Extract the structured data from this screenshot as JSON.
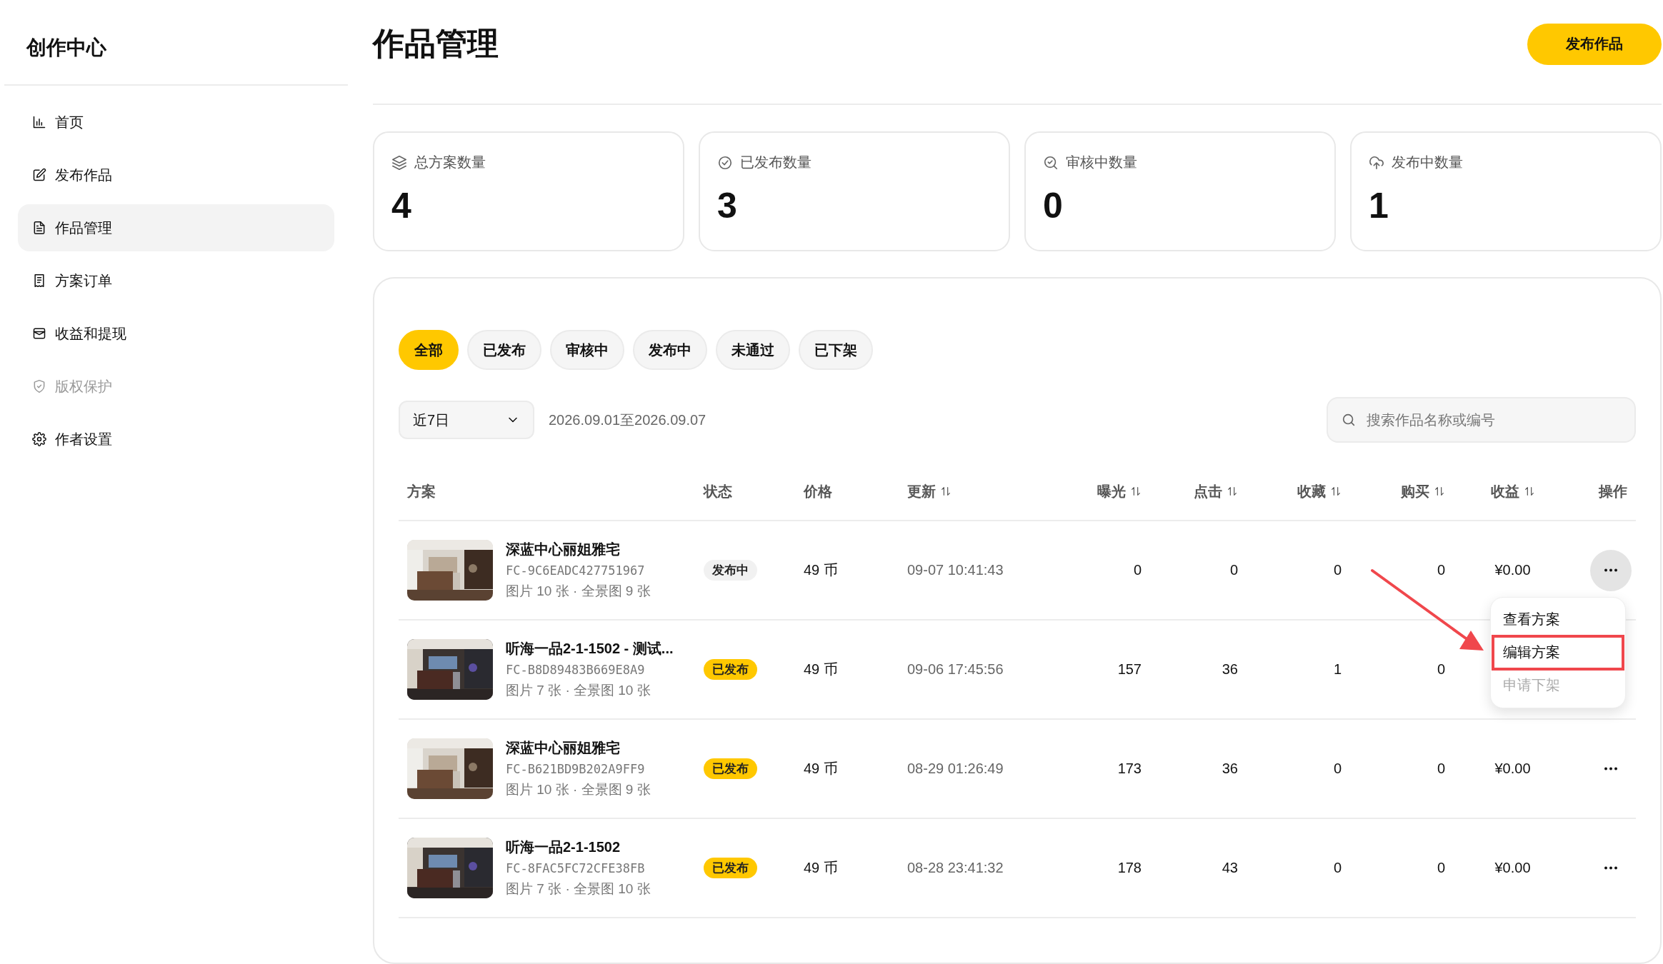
{
  "sidebar": {
    "title": "创作中心",
    "items": [
      {
        "label": "首页",
        "selected": false,
        "disabled": false
      },
      {
        "label": "发布作品",
        "selected": false,
        "disabled": false
      },
      {
        "label": "作品管理",
        "selected": true,
        "disabled": false
      },
      {
        "label": "方案订单",
        "selected": false,
        "disabled": false
      },
      {
        "label": "收益和提现",
        "selected": false,
        "disabled": false
      },
      {
        "label": "版权保护",
        "selected": false,
        "disabled": true
      },
      {
        "label": "作者设置",
        "selected": false,
        "disabled": false
      }
    ]
  },
  "header": {
    "title": "作品管理",
    "button": "发布作品"
  },
  "stats": [
    {
      "label": "总方案数量",
      "value": "4"
    },
    {
      "label": "已发布数量",
      "value": "3"
    },
    {
      "label": "审核中数量",
      "value": "0"
    },
    {
      "label": "发布中数量",
      "value": "1"
    }
  ],
  "filter_tabs": [
    {
      "label": "全部",
      "selected": true
    },
    {
      "label": "已发布",
      "selected": false
    },
    {
      "label": "审核中",
      "selected": false
    },
    {
      "label": "发布中",
      "selected": false
    },
    {
      "label": "未通过",
      "selected": false
    },
    {
      "label": "已下架",
      "selected": false
    }
  ],
  "date_select": {
    "value": "近7日"
  },
  "date_range": "2026.09.01至2026.09.07",
  "search": {
    "placeholder": "搜索作品名称或编号"
  },
  "table": {
    "columns": [
      {
        "label": "方案",
        "sortable": false
      },
      {
        "label": "状态",
        "sortable": false
      },
      {
        "label": "价格",
        "sortable": false
      },
      {
        "label": "更新",
        "sortable": true
      },
      {
        "label": "曝光",
        "sortable": true
      },
      {
        "label": "点击",
        "sortable": true
      },
      {
        "label": "收藏",
        "sortable": true
      },
      {
        "label": "购买",
        "sortable": true
      },
      {
        "label": "收益",
        "sortable": true
      },
      {
        "label": "操作",
        "sortable": false
      }
    ],
    "rows": [
      {
        "title": "深蓝中心丽姐雅宅",
        "code": "FC-9C6EADC427751967",
        "meta": "图片 10 张 · 全景图 9 张",
        "status": {
          "label": "发布中",
          "kind": "publishing"
        },
        "price": "49 币",
        "updated": "09-07 10:41:43",
        "exposure": "0",
        "clicks": "0",
        "favorites": "0",
        "purchases": "0",
        "revenue": "¥0.00",
        "menu_open": true
      },
      {
        "title": "听海一品2-1-1502 - 测试...",
        "code": "FC-B8D89483B669E8A9",
        "meta": "图片 7 张 · 全景图 10 张",
        "status": {
          "label": "已发布",
          "kind": "published"
        },
        "price": "49 币",
        "updated": "09-06 17:45:56",
        "exposure": "157",
        "clicks": "36",
        "favorites": "1",
        "purchases": "0",
        "menu_open": false
      },
      {
        "title": "深蓝中心丽姐雅宅",
        "code": "FC-B621BD9B202A9FF9",
        "meta": "图片 10 张 · 全景图 9 张",
        "status": {
          "label": "已发布",
          "kind": "published"
        },
        "price": "49 币",
        "updated": "08-29 01:26:49",
        "exposure": "173",
        "clicks": "36",
        "favorites": "0",
        "purchases": "0",
        "revenue": "¥0.00",
        "menu_open": false
      },
      {
        "title": "听海一品2-1-1502",
        "code": "FC-8FAC5FC72CFE38FB",
        "meta": "图片 7 张 · 全景图 10 张",
        "status": {
          "label": "已发布",
          "kind": "published"
        },
        "price": "49 币",
        "updated": "08-28 23:41:32",
        "exposure": "178",
        "clicks": "43",
        "favorites": "0",
        "purchases": "0",
        "revenue": "¥0.00",
        "menu_open": false
      }
    ]
  },
  "action_menu": {
    "items": [
      {
        "label": "查看方案",
        "disabled": false,
        "highlighted": false
      },
      {
        "label": "编辑方案",
        "disabled": false,
        "highlighted": true
      },
      {
        "label": "申请下架",
        "disabled": true,
        "highlighted": false
      }
    ]
  }
}
